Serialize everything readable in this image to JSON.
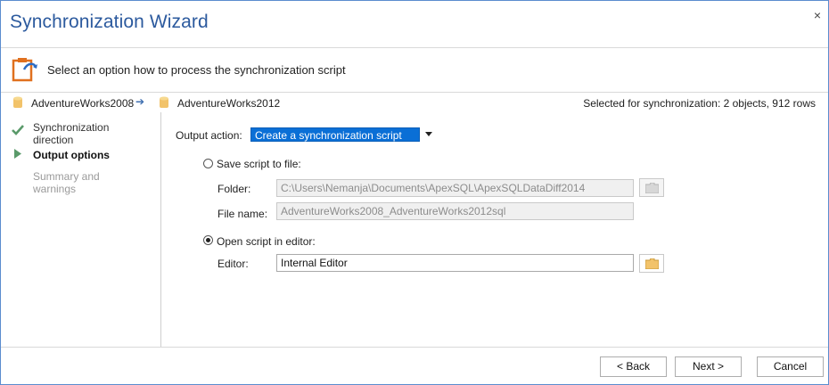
{
  "window": {
    "title": "Synchronization Wizard",
    "close": "×"
  },
  "header": {
    "instruction": "Select an option how to process the synchronization script"
  },
  "dbbar": {
    "source": "AdventureWorks2008",
    "arrow": "➔",
    "target": "AdventureWorks2012",
    "selection": "Selected for synchronization: 2 objects, 912 rows"
  },
  "steps": [
    {
      "label": "Synchronization direction",
      "state": "done"
    },
    {
      "label": "Output options",
      "state": "active"
    },
    {
      "label": "Summary and warnings",
      "state": "pending"
    }
  ],
  "output": {
    "action_label": "Output action:",
    "action_value": "Create a synchronization script",
    "save_option": "Save script to file:",
    "folder_label": "Folder:",
    "folder_value": "C:\\Users\\Nemanja\\Documents\\ApexSQL\\ApexSQLDataDiff2014",
    "filename_label": "File name:",
    "filename_value": "AdventureWorks2008_AdventureWorks2012sql",
    "open_option": "Open script in editor:",
    "editor_label": "Editor:",
    "editor_value": "Internal Editor",
    "selected_option": "open"
  },
  "buttons": {
    "back": "< Back",
    "next": "Next >",
    "cancel": "Cancel"
  },
  "colors": {
    "title": "#2c5a9e",
    "selection": "#0a6fd6",
    "check": "#5a9a6a"
  }
}
